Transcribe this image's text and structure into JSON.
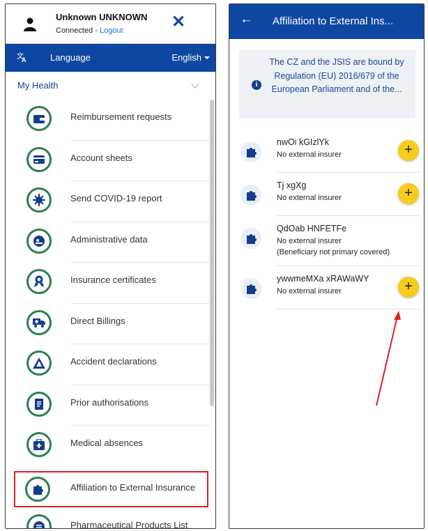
{
  "drawer": {
    "user_name": "Unknown UNKNOWN",
    "status": "Connected",
    "separator": "-",
    "logout": "Logout",
    "language_label": "Language",
    "language_value": "English",
    "section_title": "My Health",
    "items": [
      {
        "label": "Reimbursement requests",
        "icon": "wallet-icon"
      },
      {
        "label": "Account sheets",
        "icon": "card-icon"
      },
      {
        "label": "Send COVID-19 report",
        "icon": "virus-icon"
      },
      {
        "label": "Administrative data",
        "icon": "id-icon"
      },
      {
        "label": "Insurance certificates",
        "icon": "award-icon"
      },
      {
        "label": "Direct Billings",
        "icon": "ambulance-icon"
      },
      {
        "label": "Accident declarations",
        "icon": "warning-icon"
      },
      {
        "label": "Prior authorisations",
        "icon": "scroll-icon"
      },
      {
        "label": "Medical absences",
        "icon": "medkit-icon"
      },
      {
        "label": "Affiliation to External Insurance",
        "icon": "puzzle-icon"
      },
      {
        "label": "Pharmaceutical Products List",
        "icon": "list-icon"
      }
    ]
  },
  "page": {
    "title": "Affiliation to External Ins...",
    "info": "The CZ and the JSIS are bound by Regulation (EU) 2016/679 of the European Parliament and of the...",
    "beneficiaries": [
      {
        "name": "nwOi kGIzlYk",
        "status": "No external insurer",
        "note": "",
        "can_add": true
      },
      {
        "name": "Tj xgXg",
        "status": "No external insurer",
        "note": "",
        "can_add": true
      },
      {
        "name": "QdOab HNFETFe",
        "status": "No external insurer",
        "note": "(Beneficiary not primary covered)",
        "can_add": false
      },
      {
        "name": "ywwmeMXa xRAWaWY",
        "status": "No external insurer",
        "note": "",
        "can_add": true
      }
    ]
  },
  "colors": {
    "primary": "#0e47a1",
    "accent_green": "#2e7d52",
    "fab_yellow": "#f7cc1b",
    "highlight_red": "#e02020"
  }
}
